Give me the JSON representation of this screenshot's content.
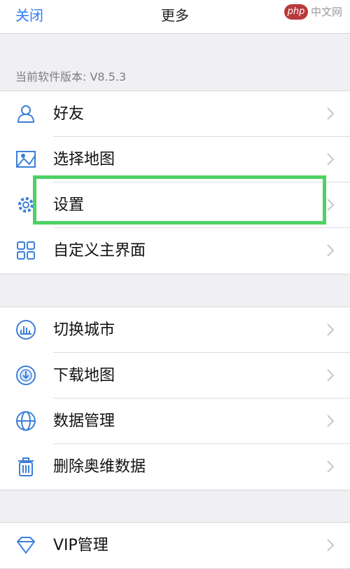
{
  "header": {
    "close_label": "关闭",
    "title": "更多",
    "watermark": {
      "logo_text": "php",
      "site_text": "中文网"
    }
  },
  "version_text": "当前软件版本: V8.5.3",
  "groups": [
    {
      "items": [
        {
          "label": "好友",
          "icon": "user-icon"
        },
        {
          "label": "选择地图",
          "icon": "map-icon"
        },
        {
          "label": "设置",
          "icon": "gear-icon"
        },
        {
          "label": "自定义主界面",
          "icon": "grid-icon"
        }
      ]
    },
    {
      "items": [
        {
          "label": "切换城市",
          "icon": "city-icon"
        },
        {
          "label": "下载地图",
          "icon": "download-icon"
        },
        {
          "label": "数据管理",
          "icon": "globe-icon"
        },
        {
          "label": "删除奥维数据",
          "icon": "trash-icon"
        }
      ]
    },
    {
      "items": [
        {
          "label": "VIP管理",
          "icon": "diamond-icon"
        }
      ]
    }
  ],
  "colors": {
    "accent": "#2f7cf6",
    "icon_blue": "#3d7fd8",
    "highlight": "#4ed164",
    "background": "#efeff4"
  }
}
